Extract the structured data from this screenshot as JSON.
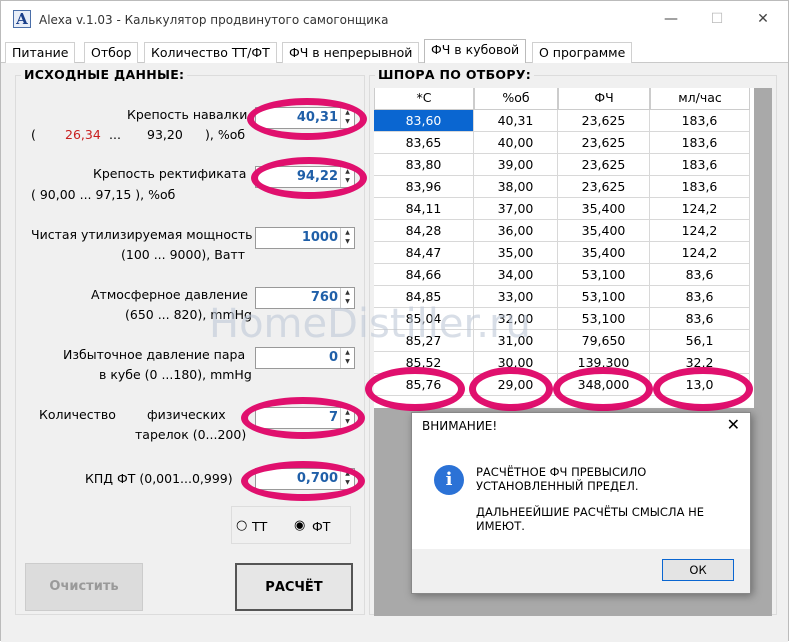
{
  "window": {
    "title": "Alexa  v.1.03 - Калькулятор продвинутого самогонщика",
    "icon": "A"
  },
  "tabs": [
    "Питание",
    "Отбор",
    "Количество ТТ/ФТ",
    "ФЧ в непрерывной",
    "ФЧ в кубовой",
    "О программе"
  ],
  "left": {
    "title": "ИСХОДНЫЕ ДАННЫЕ:",
    "wash": {
      "label": "Крепость навалки",
      "min": "26,34",
      "dots": "...",
      "max": "93,20",
      "unit": "), %об",
      "open": "(",
      "value": "40,31"
    },
    "rect": {
      "label": "Крепость ректификата",
      "range": "(      90,00        ... 97,15 ), %об",
      "value": "94,22"
    },
    "power": {
      "label": "Чистая утилизируемая мощность",
      "range": "(100 ... 9000), Ватт",
      "value": "1000"
    },
    "atm": {
      "label": "Атмосферное давление",
      "range": "(650 ... 820), mmHg",
      "value": "760"
    },
    "over": {
      "label": "Избыточное давление пара",
      "range": "в кубе (0 ...180), mmHg",
      "value": "0"
    },
    "plates": {
      "label1": "Количество",
      "label2": "физических",
      "label3": "тарелок (0...200)",
      "value": "7"
    },
    "eff": {
      "label": "КПД ФТ (0,001...0,999)",
      "value": "0,700"
    },
    "radio": {
      "tt": "ТТ",
      "ft": "ФТ"
    },
    "clear_btn": "Очистить",
    "calc_btn": "РАСЧЁТ"
  },
  "right": {
    "title": "ШПОРА ПО ОТБОРУ:",
    "headers": [
      "*C",
      "%об",
      "ФЧ",
      "мл/час"
    ],
    "rows": [
      [
        "83,60",
        "40,31",
        "23,625",
        "183,6"
      ],
      [
        "83,65",
        "40,00",
        "23,625",
        "183,6"
      ],
      [
        "83,80",
        "39,00",
        "23,625",
        "183,6"
      ],
      [
        "83,96",
        "38,00",
        "23,625",
        "183,6"
      ],
      [
        "84,11",
        "37,00",
        "35,400",
        "124,2"
      ],
      [
        "84,28",
        "36,00",
        "35,400",
        "124,2"
      ],
      [
        "84,47",
        "35,00",
        "35,400",
        "124,2"
      ],
      [
        "84,66",
        "34,00",
        "53,100",
        "83,6"
      ],
      [
        "84,85",
        "33,00",
        "53,100",
        "83,6"
      ],
      [
        "85,04",
        "32,00",
        "53,100",
        "83,6"
      ],
      [
        "85,27",
        "31,00",
        "79,650",
        "56,1"
      ],
      [
        "85,52",
        "30,00",
        "139,300",
        "32,2"
      ],
      [
        "85,76",
        "29,00",
        "348,000",
        "13,0"
      ]
    ]
  },
  "dialog": {
    "title": "ВНИМАНИЕ!",
    "line1": "РАСЧЁТНОЕ ФЧ ПРЕВЫСИЛО",
    "line2": "УСТАНОВЛЕННЫЙ ПРЕДЕЛ.",
    "line3": "ДАЛЬНЕЕЙШИЕ РАСЧЁТЫ СМЫСЛА НЕ ИМЕЮТ.",
    "ok": "ОК"
  },
  "watermark": "HomeDistiller.ru",
  "colors": {
    "highlight": "#e0106e",
    "value_blue": "#1f5fa8",
    "min_red": "#c81e1e",
    "selection": "#0a66d1"
  }
}
